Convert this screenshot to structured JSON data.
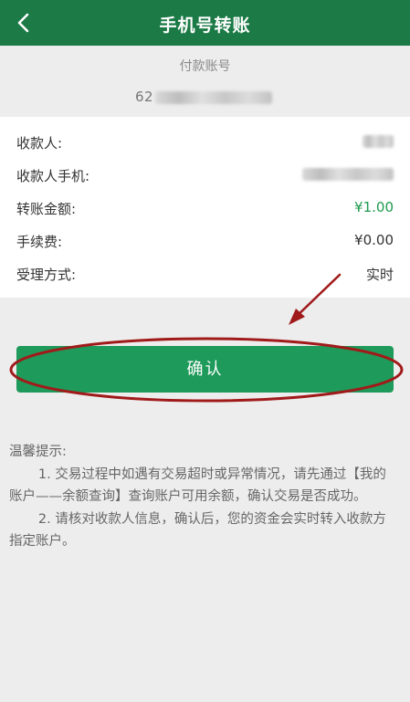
{
  "header": {
    "title": "手机号转账",
    "back_icon": "chevron-left-icon",
    "background": "#1b7a45"
  },
  "payer": {
    "label": "付款账号",
    "account_visible": "62"
  },
  "details": [
    {
      "label": "收款人:",
      "value": ""
    },
    {
      "label": "收款人手机:",
      "value": ""
    },
    {
      "label": "转账金额:",
      "value": "¥1.00",
      "color": "#1e9a4e"
    },
    {
      "label": "手续费:",
      "value": "¥0.00"
    },
    {
      "label": "受理方式:",
      "value": "实时"
    }
  ],
  "confirm": {
    "label": "确认",
    "color": "#1e9a5a"
  },
  "annotation_color": "#a11a1a",
  "tips": {
    "title": "温馨提示:",
    "items": [
      "1. 交易过程中如遇有交易超时或异常情况，请先通过【我的账户——余额查询】查询账户可用余额，确认交易是否成功。",
      "2. 请核对收款人信息，确认后，您的资金会实时转入收款方指定账户。"
    ]
  }
}
